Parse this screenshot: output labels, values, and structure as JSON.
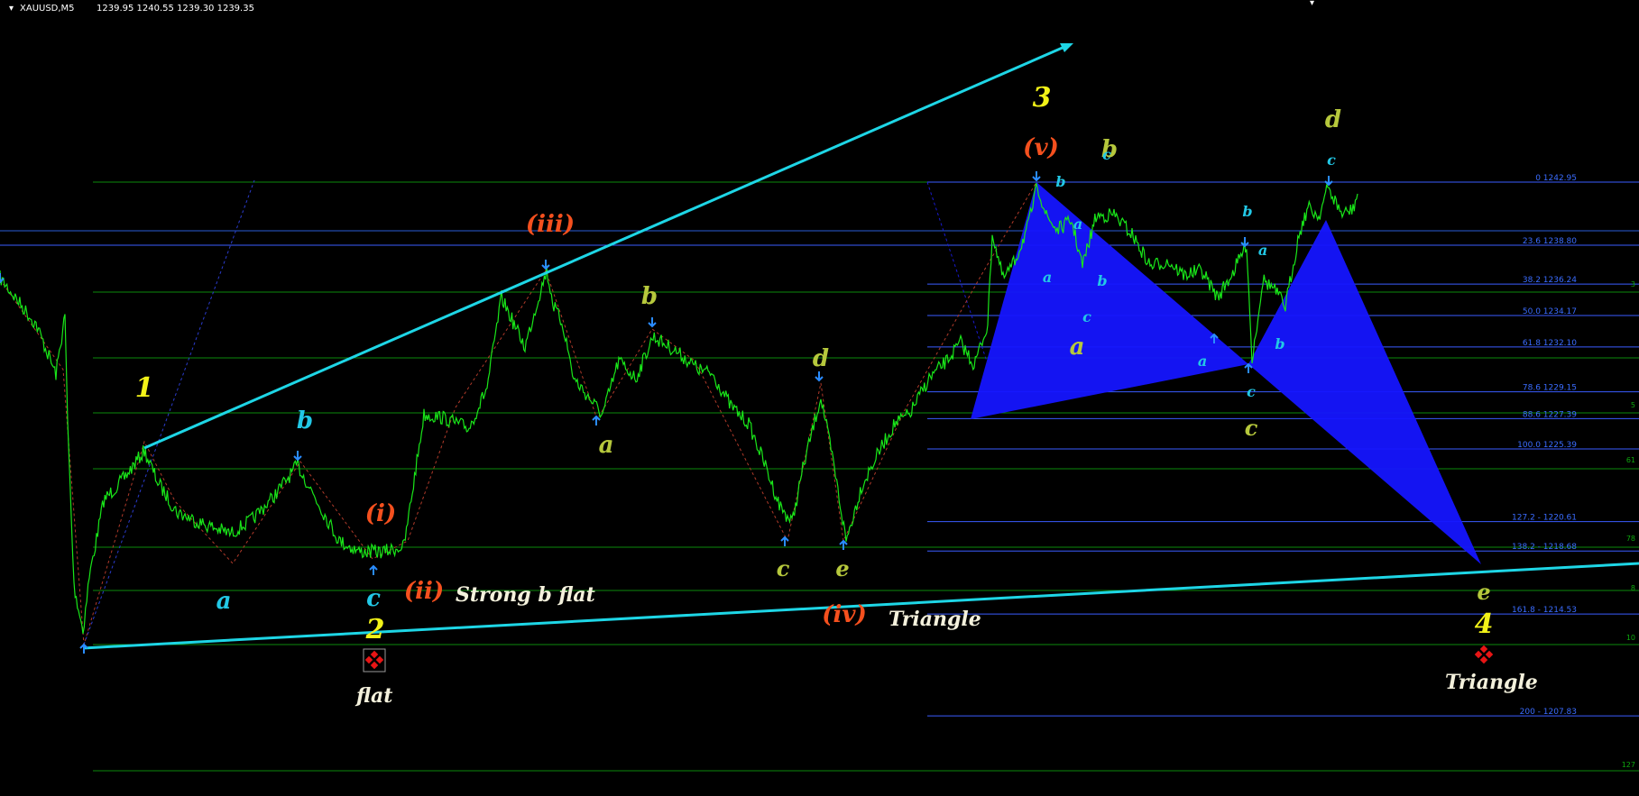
{
  "header": {
    "symbol_timeframe": "XAUUSD,M5",
    "ohlc": "1239.95 1240.55 1239.30 1239.35"
  },
  "colors": {
    "background": "#000000",
    "price": "#19e619",
    "grid": "#0d8a0d",
    "fib": "#3a5cff",
    "channel": "#1ed6e6",
    "harmonic": "#1515ff",
    "dashed": "#b03a2a",
    "label_yellow": "#f2f218",
    "label_orange": "#f5501e",
    "label_olive": "#b6c83c",
    "label_cyan": "#22c8e6",
    "label_white": "#f4f1dc"
  },
  "chart_data": {
    "type": "line",
    "title": "",
    "series": [
      {
        "values": []
      }
    ],
    "fibonacci_levels": [
      {
        "level": "0",
        "price": 1242.95,
        "label": "0 1242.95"
      },
      {
        "level": "23.6",
        "price": 1238.8,
        "label": "23.6 1238.80"
      },
      {
        "level": "38.2",
        "price": 1236.24,
        "label": "38.2 1236.24"
      },
      {
        "level": "50.0",
        "price": 1234.17,
        "label": "50.0 1234.17"
      },
      {
        "level": "61.8",
        "price": 1232.1,
        "label": "61.8 1232.10"
      },
      {
        "level": "78.6",
        "price": 1229.15,
        "label": "78.6 1229.15"
      },
      {
        "level": "88.6",
        "price": 1227.39,
        "label": "88.6 1227.39"
      },
      {
        "level": "100.0",
        "price": 1225.39,
        "label": "100.0 1225.39"
      },
      {
        "level": "127.2",
        "price": 1220.61,
        "label": "127.2 - 1220.61"
      },
      {
        "level": "138.2",
        "price": 1218.68,
        "label": "138.2 - 1218.68"
      },
      {
        "level": "161.8",
        "price": 1214.53,
        "label": "161.8 - 1214.53"
      },
      {
        "level": "200",
        "price": 1207.83,
        "label": "200 - 1207.83"
      }
    ],
    "right_edge_labels": [
      "3",
      "5",
      "61",
      "78",
      "8",
      "10",
      "127"
    ],
    "wave_labels": [
      {
        "text": "1",
        "color": "label_yellow",
        "size": 30
      },
      {
        "text": "2",
        "color": "label_yellow",
        "size": 30
      },
      {
        "text": "3",
        "color": "label_yellow",
        "size": 30
      },
      {
        "text": "4",
        "color": "label_yellow",
        "size": 30
      },
      {
        "text": "(i)",
        "color": "label_orange",
        "size": 26
      },
      {
        "text": "(ii)",
        "color": "label_orange",
        "size": 26
      },
      {
        "text": "(iii)",
        "color": "label_orange",
        "size": 26
      },
      {
        "text": "(iv)",
        "color": "label_orange",
        "size": 26
      },
      {
        "text": "(v)",
        "color": "label_orange",
        "size": 26
      },
      {
        "text": "a",
        "color": "label_cyan",
        "size": 26
      },
      {
        "text": "b",
        "color": "label_cyan",
        "size": 26
      },
      {
        "text": "c",
        "color": "label_cyan",
        "size": 26
      },
      {
        "text": "b",
        "color": "label_olive",
        "size": 26
      },
      {
        "text": "a",
        "color": "label_olive",
        "size": 26
      },
      {
        "text": "d",
        "color": "label_olive",
        "size": 26
      },
      {
        "text": "c",
        "color": "label_olive",
        "size": 24
      },
      {
        "text": "e",
        "color": "label_olive",
        "size": 24
      },
      {
        "text": "b",
        "color": "label_olive",
        "size": 26
      },
      {
        "text": "a",
        "color": "label_olive",
        "size": 26
      },
      {
        "text": "c",
        "color": "label_olive",
        "size": 24
      },
      {
        "text": "d",
        "color": "label_olive",
        "size": 26
      },
      {
        "text": "e",
        "color": "label_olive",
        "size": 24
      },
      {
        "text": "b",
        "color": "label_cyan",
        "size": 16
      },
      {
        "text": "c",
        "color": "label_cyan",
        "size": 16
      },
      {
        "text": "a",
        "color": "label_cyan",
        "size": 16
      },
      {
        "text": "b",
        "color": "label_cyan",
        "size": 16
      },
      {
        "text": "a",
        "color": "label_cyan",
        "size": 16
      },
      {
        "text": "c",
        "color": "label_cyan",
        "size": 16
      },
      {
        "text": "a",
        "color": "label_cyan",
        "size": 16
      },
      {
        "text": "b",
        "color": "label_cyan",
        "size": 16
      },
      {
        "text": "a",
        "color": "label_cyan",
        "size": 16
      },
      {
        "text": "c",
        "color": "label_cyan",
        "size": 16
      },
      {
        "text": "b",
        "color": "label_cyan",
        "size": 16
      },
      {
        "text": "c",
        "color": "label_cyan",
        "size": 16
      }
    ],
    "annotations": [
      {
        "text": "Strong b flat",
        "color": "label_white",
        "size": 22
      },
      {
        "text": "Triangle",
        "color": "label_white",
        "size": 22
      },
      {
        "text": "flat",
        "color": "label_white",
        "size": 22
      },
      {
        "text": "Triangle",
        "color": "label_white",
        "size": 22
      }
    ]
  }
}
